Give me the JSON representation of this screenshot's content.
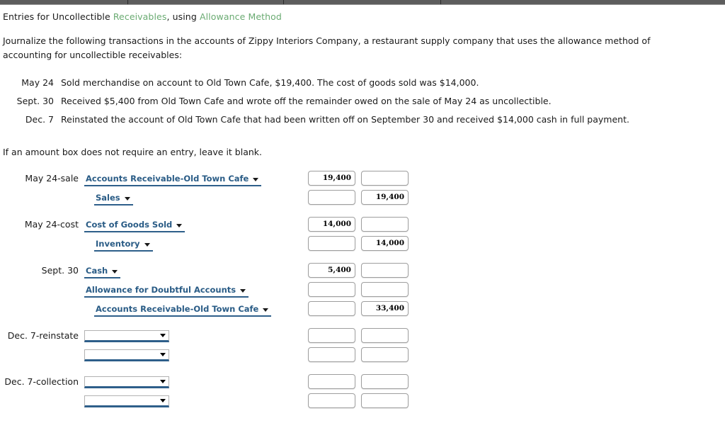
{
  "window": {
    "chrome_separator_positions": [
      180,
      400,
      622
    ]
  },
  "header": {
    "title_pre": "Entries for Uncollectible ",
    "title_kw1": "Receivables",
    "title_mid": ", using ",
    "title_kw2": "Allowance Method",
    "keyword_color": "#6aab72"
  },
  "intro": {
    "text": "Journalize the following transactions in the accounts of Zippy Interiors Company, a restaurant supply company that uses the allowance method of accounting for uncollectible receivables:"
  },
  "transactions": [
    {
      "date": "May 24",
      "description": "Sold merchandise on account to Old Town Cafe, $19,400. The cost of goods sold was $14,000."
    },
    {
      "date": "Sept. 30",
      "description": "Received $5,400 from Old Town Cafe and wrote off the remainder owed on the sale of May 24 as uncollectible."
    },
    {
      "date": "Dec. 7",
      "description": "Reinstated the account of Old Town Cafe that had been written off on September 30 and received $14,000 cash in full payment."
    }
  ],
  "note": {
    "text": "If an amount box does not require an entry, leave it blank."
  },
  "journal": {
    "accent_color": "#2e5f8a",
    "groups": [
      {
        "label": "May 24-sale",
        "lines": [
          {
            "account": "Accounts Receivable-Old Town Cafe",
            "filled": true,
            "indent": 0,
            "debit": "19,400",
            "credit": ""
          },
          {
            "account": "Sales",
            "filled": true,
            "indent": 1,
            "debit": "",
            "credit": "19,400"
          }
        ]
      },
      {
        "label": "May 24-cost",
        "lines": [
          {
            "account": "Cost of Goods Sold",
            "filled": true,
            "indent": 0,
            "debit": "14,000",
            "credit": ""
          },
          {
            "account": "Inventory",
            "filled": true,
            "indent": 1,
            "debit": "",
            "credit": "14,000"
          }
        ]
      },
      {
        "label": "Sept. 30",
        "lines": [
          {
            "account": "Cash",
            "filled": true,
            "indent": 0,
            "debit": "5,400",
            "credit": ""
          },
          {
            "account": "Allowance for Doubtful Accounts",
            "filled": true,
            "indent": 0,
            "debit": "",
            "credit": ""
          },
          {
            "account": "Accounts Receivable-Old Town Cafe",
            "filled": true,
            "indent": 1,
            "debit": "",
            "credit": "33,400"
          }
        ]
      },
      {
        "label": "Dec. 7-reinstate",
        "lines": [
          {
            "account": "",
            "filled": false,
            "indent": 0,
            "debit": "",
            "credit": ""
          },
          {
            "account": "",
            "filled": false,
            "indent": 0,
            "debit": "",
            "credit": ""
          }
        ]
      },
      {
        "label": "Dec. 7-collection",
        "lines": [
          {
            "account": "",
            "filled": false,
            "indent": 0,
            "debit": "",
            "credit": ""
          },
          {
            "account": "",
            "filled": false,
            "indent": 0,
            "debit": "",
            "credit": ""
          }
        ]
      }
    ]
  }
}
